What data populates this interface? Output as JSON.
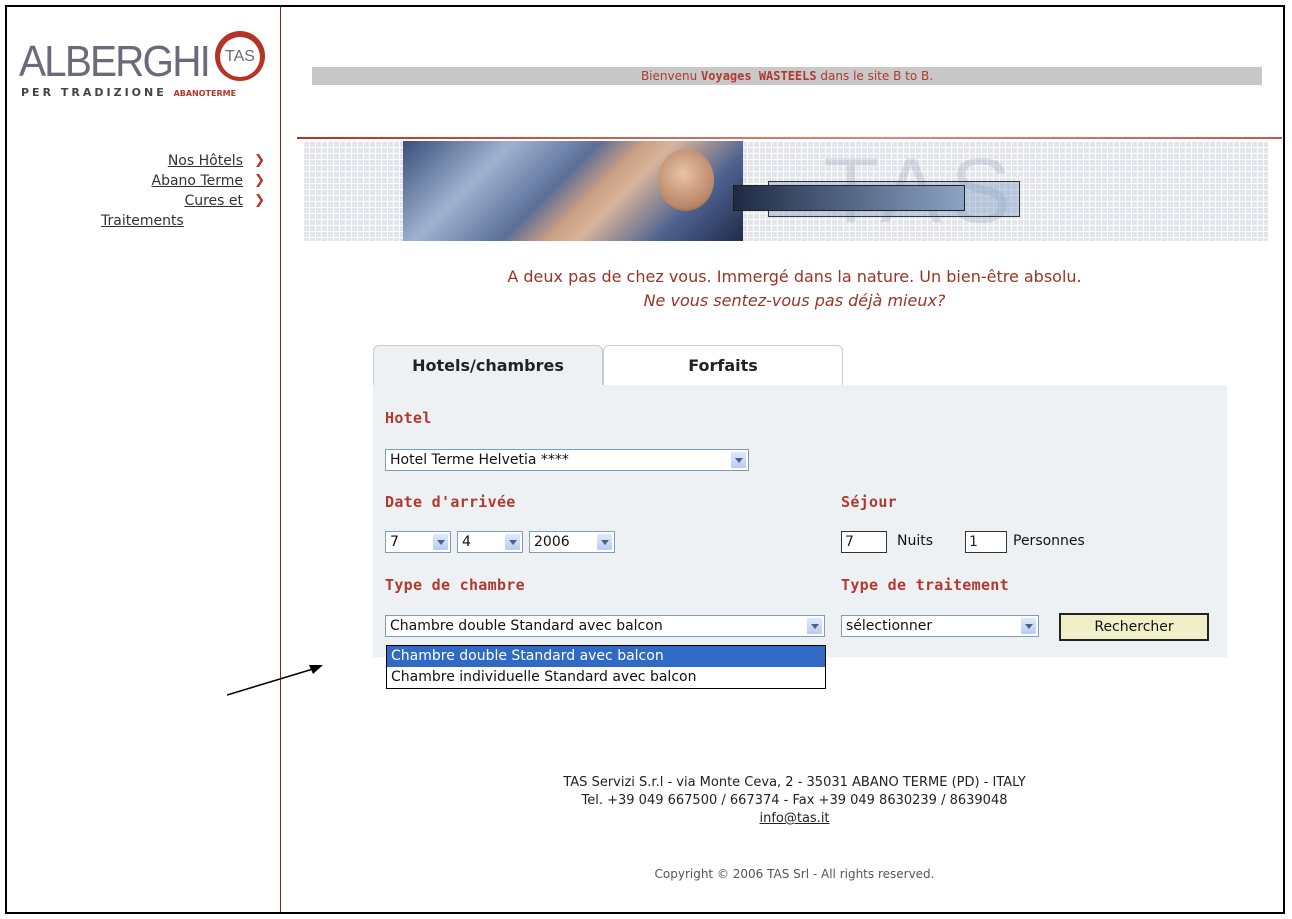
{
  "header": {
    "logo_text": "ALBERGHI",
    "logo_badge": "TAS",
    "logo_subtitle": "PER TRADIZIONE",
    "logo_subtitle_b": "ABANOTERME",
    "welcome_prefix": "Bienvenu ",
    "welcome_name": "Voyages WASTEELS",
    "welcome_suffix": " dans le site B to B."
  },
  "sidebar": {
    "items": [
      {
        "label": "Nos Hôtels"
      },
      {
        "label": "Abano Terme"
      },
      {
        "label_line1": "Cures et",
        "label_line2": "Traitements"
      }
    ],
    "chevron": "❯"
  },
  "banner": {
    "watermark": "TAS"
  },
  "tagline": {
    "line1": "A deux pas de chez vous. Immergé dans la nature. Un bien-être absolu.",
    "line2": "Ne vous sentez-vous pas déjà mieux?"
  },
  "tabs": [
    {
      "label": "Hotels/chambres",
      "active": true
    },
    {
      "label": "Forfaits",
      "active": false
    }
  ],
  "form": {
    "hotel_label": "Hotel",
    "hotel_value": "Hotel Terme Helvetia ****",
    "arrival_label": "Date d'arrivée",
    "arrival_day": "7",
    "arrival_month": "4",
    "arrival_year": "2006",
    "stay_label": "Séjour",
    "nights_value": "7",
    "nights_label": "Nuits",
    "persons_value": "1",
    "persons_label": "Personnes",
    "room_type_label": "Type de chambre",
    "room_type_value": "Chambre double Standard avec balcon",
    "room_type_options": [
      "Chambre double Standard avec balcon",
      "Chambre individuelle Standard avec balcon"
    ],
    "treatment_label": "Type de traitement",
    "treatment_value": "sélectionner",
    "search_button": "Rechercher"
  },
  "footer": {
    "line1": "TAS Servizi S.r.l - via Monte Ceva, 2 - 35031 ABANO TERME (PD) - ITALY",
    "line2": "Tel. +39 049 667500 / 667374 - Fax +39 049 8630239 / 8639048",
    "email": "info@tas.it",
    "copyright": "Copyright © 2006 TAS Srl - All rights reserved."
  },
  "colors": {
    "accent_red": "#b03a2e",
    "selection_blue": "#316ac5",
    "panel_bg": "#eef1f4"
  }
}
